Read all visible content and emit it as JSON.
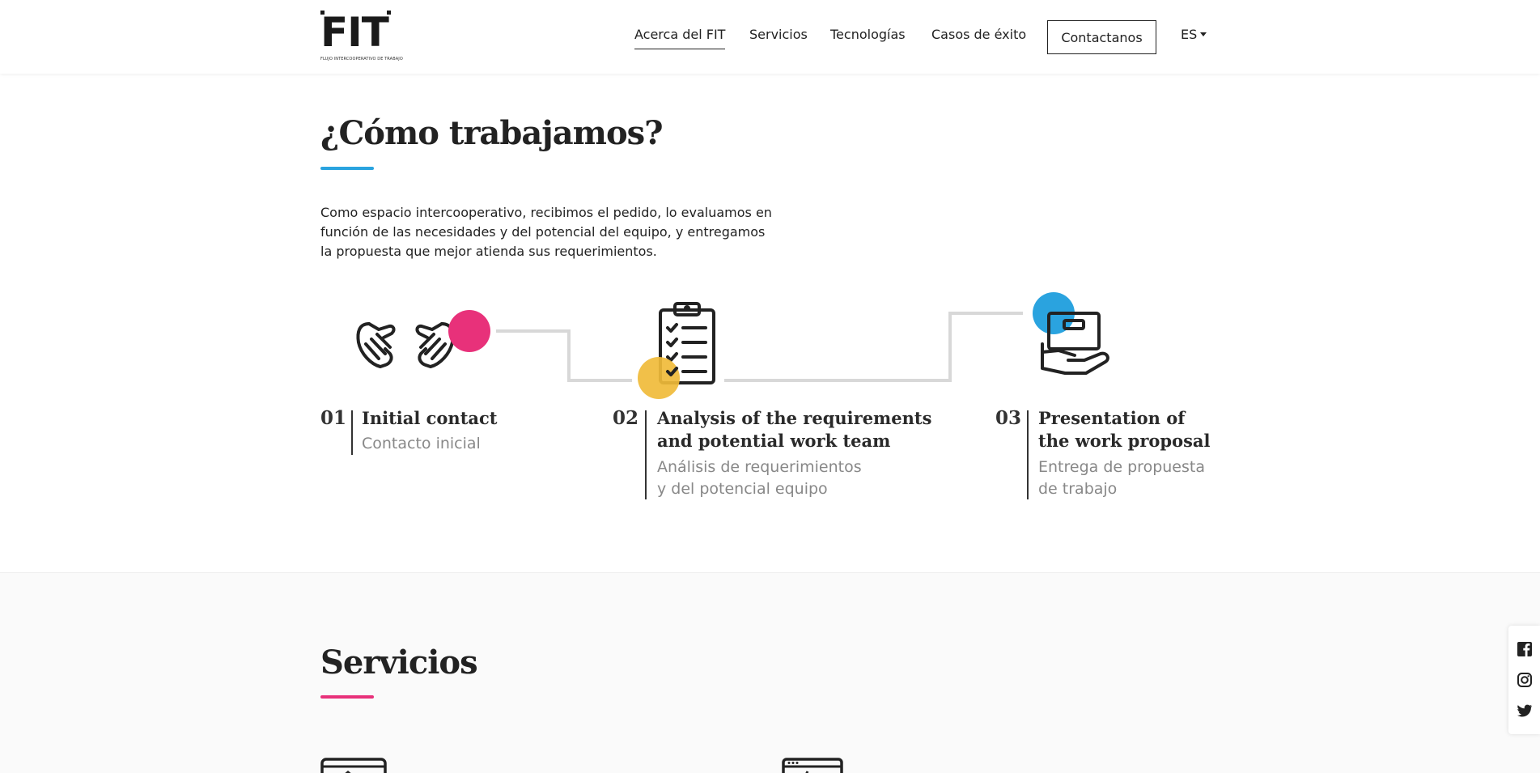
{
  "header": {
    "logo_text": "FIT",
    "logo_subtitle": "FLUJO INTERCOOPERATIVO DE TRABAJO",
    "nav": [
      {
        "label": "Acerca del FIT",
        "active": true
      },
      {
        "label": "Servicios",
        "active": false
      },
      {
        "label": "Tecnologías",
        "active": false
      },
      {
        "label": "Casos de éxito",
        "active": false
      }
    ],
    "contact_label": "Contactanos",
    "language": "ES"
  },
  "how_we_work": {
    "title": "¿Cómo trabajamos?",
    "accent_color": "#2aa3df",
    "intro": "Como espacio intercooperativo, recibimos el pedido, lo evaluamos en función de las necesidades y del potencial del equipo, y entregamos la propuesta que mejor atienda sus requerimientos.",
    "steps": [
      {
        "number": "01",
        "title_line1": "Initial contact",
        "title_line2": "",
        "subtitle_line1": "Contacto inicial",
        "subtitle_line2": "",
        "icon": "handshake-icon",
        "dot_color": "#e8317a"
      },
      {
        "number": "02",
        "title_line1": "Analysis of the requirements",
        "title_line2": "and potential work team",
        "subtitle_line1": "Análisis de requerimientos",
        "subtitle_line2": "y del potencial equipo",
        "icon": "clipboard-checklist-icon",
        "dot_color": "#f0bb3a"
      },
      {
        "number": "03",
        "title_line1": "Presentation of",
        "title_line2": "the work proposal",
        "subtitle_line1": "Entrega de propuesta",
        "subtitle_line2": "de trabajo",
        "icon": "hand-box-icon",
        "dot_color": "#2aa3df"
      }
    ],
    "connector_color": "#d8d8d8"
  },
  "services": {
    "title": "Servicios",
    "accent_color": "#e8317a"
  },
  "social": [
    "facebook-icon",
    "instagram-icon",
    "twitter-icon"
  ]
}
